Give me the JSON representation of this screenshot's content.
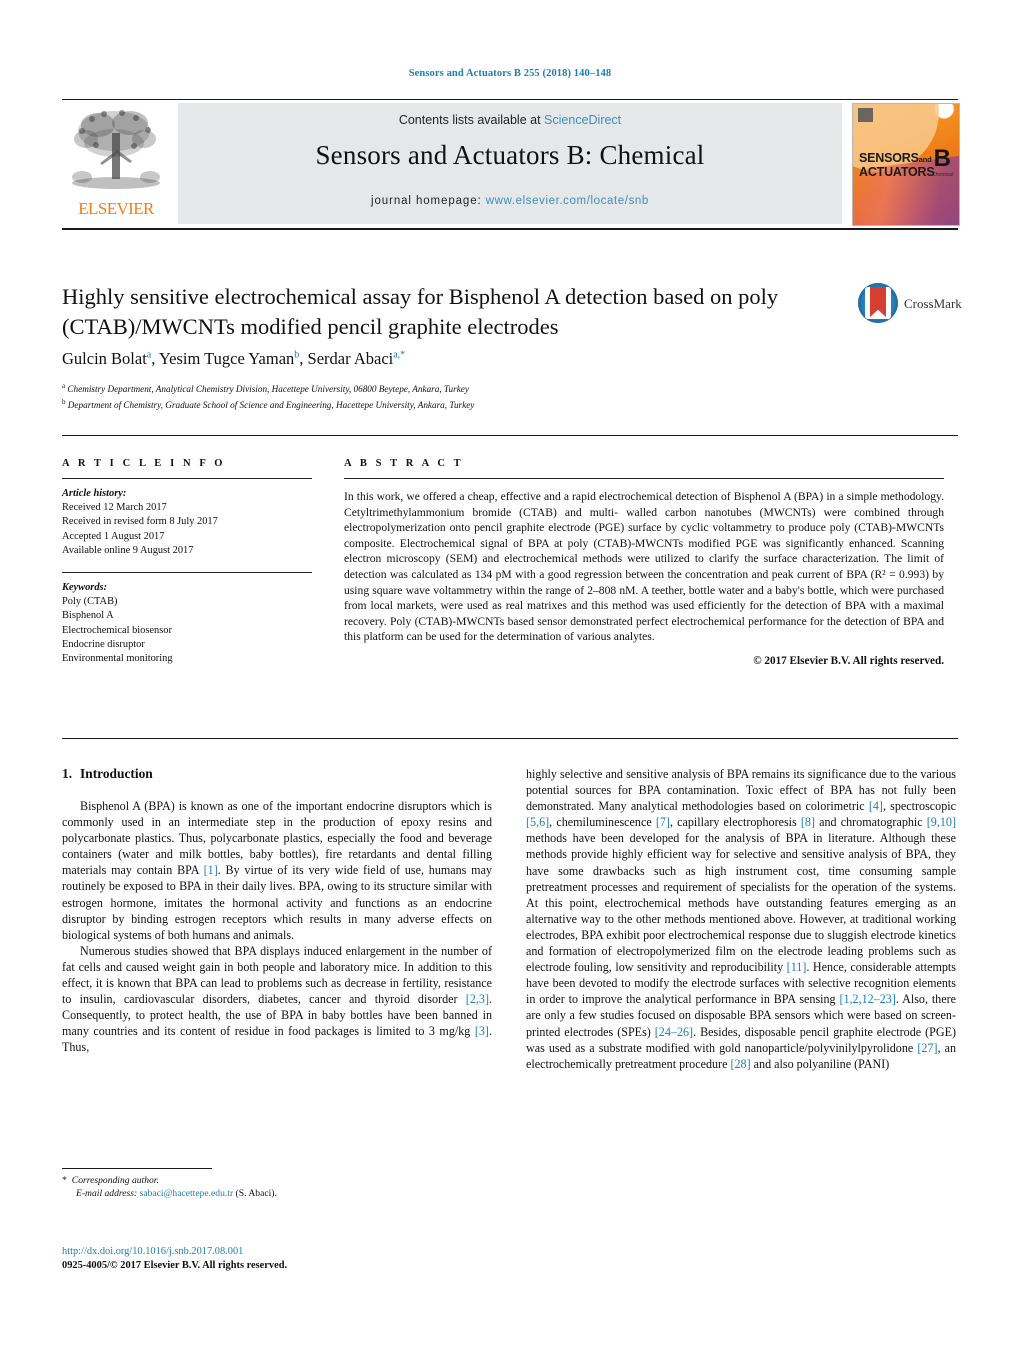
{
  "running_head": "Sensors and Actuators B 255 (2018) 140–148",
  "masthead": {
    "publisher": "ELSEVIER",
    "contents_prefix": "Contents lists available at",
    "contents_link": "ScienceDirect",
    "journal_title": "Sensors and Actuators B: Chemical",
    "homepage_label": "journal homepage:",
    "homepage_url": "www.elsevier.com/locate/snb",
    "cover": {
      "line1": "SENSORS",
      "line1_suffix": "and",
      "line2": "ACTUATORS",
      "letter": "B",
      "letter_sub": "Chemical"
    }
  },
  "article": {
    "title": "Highly sensitive electrochemical assay for Bisphenol A detection based on poly (CTAB)/MWCNTs modified pencil graphite electrodes",
    "crossmark_label": "CrossMark",
    "authors": [
      {
        "name": "Gulcin Bolat",
        "sup": "a"
      },
      {
        "name": "Yesim Tugce Yaman",
        "sup": "b"
      },
      {
        "name": "Serdar Abaci",
        "sup": "a,*"
      }
    ],
    "affiliations": [
      {
        "mark": "a",
        "text": "Chemistry Department, Analytical Chemistry Division, Hacettepe University, 06800 Beytepe, Ankara, Turkey"
      },
      {
        "mark": "b",
        "text": "Department of Chemistry, Graduate School of Science and Engineering, Hacettepe University, Ankara, Turkey"
      }
    ]
  },
  "info": {
    "heading": "A R T I C L E   I N F O",
    "history_label": "Article history:",
    "history": [
      "Received 12 March 2017",
      "Received in revised form 8 July 2017",
      "Accepted 1 August 2017",
      "Available online 9 August 2017"
    ],
    "keywords_label": "Keywords:",
    "keywords": [
      "Poly (CTAB)",
      "Bisphenol A",
      "Electrochemical biosensor",
      "Endocrine disruptor",
      "Environmental monitoring"
    ]
  },
  "abstract": {
    "heading": "A B S T R A C T",
    "text": "In this work, we offered a cheap, effective and a rapid electrochemical detection of Bisphenol A (BPA) in a simple methodology. Cetyltrimethylammonium bromide (CTAB) and multi- walled carbon nanotubes (MWCNTs) were combined through electropolymerization onto pencil graphite electrode (PGE) surface by cyclic voltammetry to produce poly (CTAB)-MWCNTs composite. Electrochemical signal of BPA at poly (CTAB)-MWCNTs modified PGE was significantly enhanced. Scanning electron microscopy (SEM) and electrochemical methods were utilized to clarify the surface characterization. The limit of detection was calculated as 134 pM with a good regression between the concentration and peak current of BPA (R² = 0.993) by using square wave voltammetry within the range of 2–808 nM. A teether, bottle water and a baby's bottle, which were purchased from local markets, were used as real matrixes and this method was used efficiently for the detection of BPA with a maximal recovery. Poly (CTAB)-MWCNTs based sensor demonstrated perfect electrochemical performance for the detection of BPA and this platform can be used for the determination of various analytes.",
    "rights": "© 2017 Elsevier B.V. All rights reserved."
  },
  "introduction": {
    "number": "1.",
    "heading": "Introduction",
    "left_paragraphs": [
      "Bisphenol A (BPA) is known as one of the important endocrine disruptors which is commonly used in an intermediate step in the production of epoxy resins and polycarbonate plastics. Thus, polycarbonate plastics, especially the food and beverage containers (water and milk bottles, baby bottles), fire retardants and dental filling materials may contain BPA [1]. By virtue of its very wide field of use, humans may routinely be exposed to BPA in their daily lives. BPA, owing to its structure similar with estrogen hormone, imitates the hormonal activity and functions as an endocrine disruptor by binding estrogen receptors which results in many adverse effects on biological systems of both humans and animals.",
      "Numerous studies showed that BPA displays induced enlargement in the number of fat cells and caused weight gain in both people and laboratory mice. In addition to this effect, it is known that BPA can lead to problems such as decrease in fertility, resistance to insulin, cardiovascular disorders, diabetes, cancer and thyroid disorder [2,3]. Consequently, to protect health, the use of BPA in baby bottles have been banned in many countries and its content of residue in food packages is limited to 3 mg/kg [3]. Thus,"
    ],
    "right_paragraph": "highly selective and sensitive analysis of BPA remains its significance due to the various potential sources for BPA contamination. Toxic effect of BPA has not fully been demonstrated. Many analytical methodologies based on colorimetric [4], spectroscopic [5,6], chemiluminescence [7], capillary electrophoresis [8] and chromatographic [9,10] methods have been developed for the analysis of BPA in literature. Although these methods provide highly efficient way for selective and sensitive analysis of BPA, they have some drawbacks such as high instrument cost, time consuming sample pretreatment processes and requirement of specialists for the operation of the systems. At this point, electrochemical methods have outstanding features emerging as an alternative way to the other methods mentioned above. However, at traditional working electrodes, BPA exhibit poor electrochemical response due to sluggish electrode kinetics and formation of electropolymerized film on the electrode leading problems such as electrode fouling, low sensitivity and reproducibility [11]. Hence, considerable attempts have been devoted to modify the electrode surfaces with selective recognition elements in order to improve the analytical performance in BPA sensing [1,2,12–23]. Also, there are only a few studies focused on disposable BPA sensors which were based on screen-printed electrodes (SPEs) [24–26]. Besides, disposable pencil graphite electrode (PGE) was used as a substrate modified with gold nanoparticle/polyvinilylpyrolidone [27], an electrochemically pretreatment procedure [28] and also polyaniline (PANI)"
  },
  "footer": {
    "corresponding_label": "Corresponding author.",
    "email_label": "E-mail address:",
    "email": "sabaci@hacettepe.edu.tr",
    "email_suffix": "(S. Abaci).",
    "doi_url": "http://dx.doi.org/10.1016/j.snb.2017.08.001",
    "issn_line": "0925-4005/© 2017 Elsevier B.V. All rights reserved."
  },
  "colors": {
    "link": "#1a7fb3",
    "elsevier_orange": "#f07f13",
    "band_gray": "#e6e7e8"
  }
}
